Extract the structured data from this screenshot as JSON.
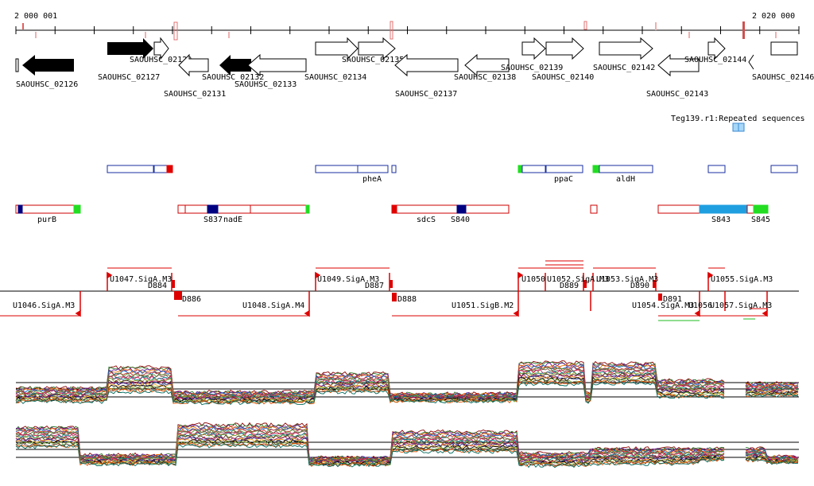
{
  "coords": {
    "start": "2 000 001",
    "end": "2 020 000"
  },
  "genes": [
    {
      "id": "SAOUHSC_02126",
      "strand": "-",
      "fill": "black"
    },
    {
      "id": "SAOUHSC_02127",
      "strand": "+",
      "fill": "black"
    },
    {
      "id": "SAOUHSC_02129",
      "strand": "+",
      "fill": "white"
    },
    {
      "id": "SAOUHSC_02131",
      "strand": "-",
      "fill": "white"
    },
    {
      "id": "SAOUHSC_02132",
      "strand": "-",
      "fill": "black"
    },
    {
      "id": "SAOUHSC_02133",
      "strand": "-",
      "fill": "white"
    },
    {
      "id": "SAOUHSC_02134",
      "strand": "+",
      "fill": "white"
    },
    {
      "id": "SAOUHSC_02135",
      "strand": "+",
      "fill": "white"
    },
    {
      "id": "SAOUHSC_02137",
      "strand": "-",
      "fill": "white"
    },
    {
      "id": "SAOUHSC_02138",
      "strand": "-",
      "fill": "white"
    },
    {
      "id": "SAOUHSC_02139",
      "strand": "+",
      "fill": "white"
    },
    {
      "id": "SAOUHSC_02140",
      "strand": "+",
      "fill": "white"
    },
    {
      "id": "SAOUHSC_02142",
      "strand": "+",
      "fill": "white"
    },
    {
      "id": "SAOUHSC_02143",
      "strand": "-",
      "fill": "white"
    },
    {
      "id": "SAOUHSC_02144",
      "strand": "+",
      "fill": "white"
    },
    {
      "id": "SAOUHSC_02146",
      "strand": "+",
      "fill": "white"
    }
  ],
  "repeat_track_label": "Teg139.r1:Repeated sequences",
  "feature_labels": {
    "plus": [
      "pheA",
      "ppaC",
      "aldH"
    ],
    "minus": [
      "purB",
      "S837",
      "nadE",
      "sdcS",
      "S840",
      "S843",
      "S845"
    ]
  },
  "promoters": {
    "upper": [
      "U1047.SigA.M3",
      "D884",
      "U1049.SigA.M3",
      "D887",
      "U1050",
      "U1052.SigA.M3",
      "D889",
      "U1053.SigA.M3",
      "D890",
      "U1055.SigA.M3"
    ],
    "lower": [
      "U1046.SigA.M3",
      "D886",
      "U1048.SigA.M4",
      "D888",
      "U1051.SigB.M2",
      "D891",
      "U1054.SigA.M3",
      "U1056",
      "U1057.SigA.M3"
    ]
  },
  "colors": {
    "plus_strand": "#1a2fa0",
    "minus_strand": "#cc0000",
    "promoter": "#dd0000",
    "green_end": "#22dd22",
    "navy_block": "#000080",
    "blue_block": "#1f9fe0"
  }
}
